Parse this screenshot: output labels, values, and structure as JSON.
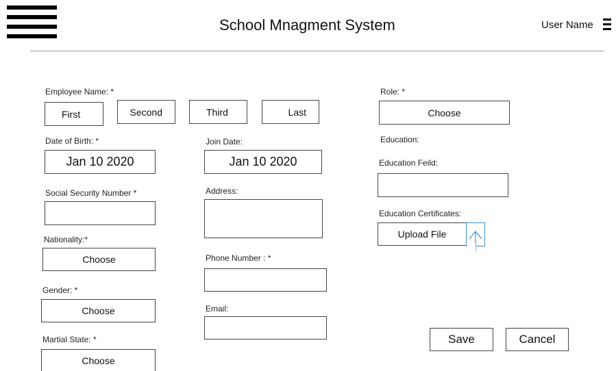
{
  "header": {
    "title": "School Mnagment System",
    "user_name": "User Name"
  },
  "form": {
    "employee_name": {
      "label": "Employee Name: *",
      "first": "First",
      "second": "Second",
      "third": "Third",
      "last": "Last"
    },
    "date_of_birth": {
      "label": "Date of Birth: *",
      "value": "Jan 10 2020"
    },
    "join_date": {
      "label": "Join Date:",
      "value": "Jan 10 2020"
    },
    "ssn": {
      "label": "Social Security Number *",
      "value": ""
    },
    "address": {
      "label": "Address:",
      "value": ""
    },
    "nationality": {
      "label": "Nationality:*",
      "value": "Choose"
    },
    "phone": {
      "label": "Phone Number : *",
      "value": ""
    },
    "gender": {
      "label": "Gender: *",
      "value": "Choose"
    },
    "email": {
      "label": "Email:",
      "value": ""
    },
    "marital_state": {
      "label": "Martial State: *",
      "value": "Choose"
    },
    "role": {
      "label": "Role: *",
      "value": "Choose"
    },
    "education": {
      "label": "Education:",
      "field_label": "Education Feild:",
      "field_value": "",
      "certificates_label": "Education Certificates:",
      "upload_label": "Upload File"
    }
  },
  "actions": {
    "save": "Save",
    "cancel": "Cancel"
  },
  "colors": {
    "upload_icon": "#3a8fd6",
    "divider": "#999999"
  }
}
